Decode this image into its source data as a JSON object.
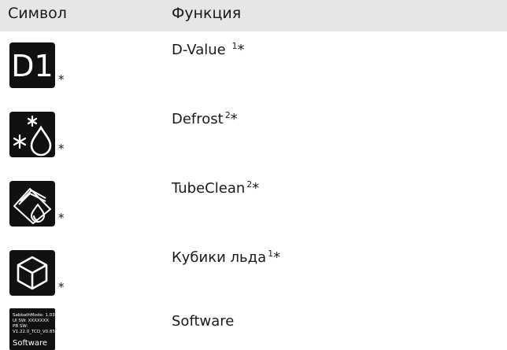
{
  "header": {
    "col_symbol": "Символ",
    "col_function": "Функция"
  },
  "rows": [
    {
      "icon": "d1-icon",
      "icon_text": "D1",
      "asterisk": "*",
      "function": "D-Value ",
      "sup": "1",
      "star": "*"
    },
    {
      "icon": "defrost-icon",
      "asterisk": "*",
      "function": "Defrost",
      "sup": "2",
      "star": "*"
    },
    {
      "icon": "tubeclean-icon",
      "asterisk": "*",
      "function": "TubeClean",
      "sup": "2",
      "star": "*"
    },
    {
      "icon": "ice-cube-icon",
      "asterisk": "*",
      "function": "Кубики льда",
      "sup": "1",
      "star": "*"
    },
    {
      "icon": "software-icon",
      "function": "Software",
      "screen_lines": "SabbathMode: 1.03\nUI SW: XXXXXXX\nPB SW:\nV1.22.0_TCD_V0.85",
      "screen_label": "Software"
    }
  ]
}
